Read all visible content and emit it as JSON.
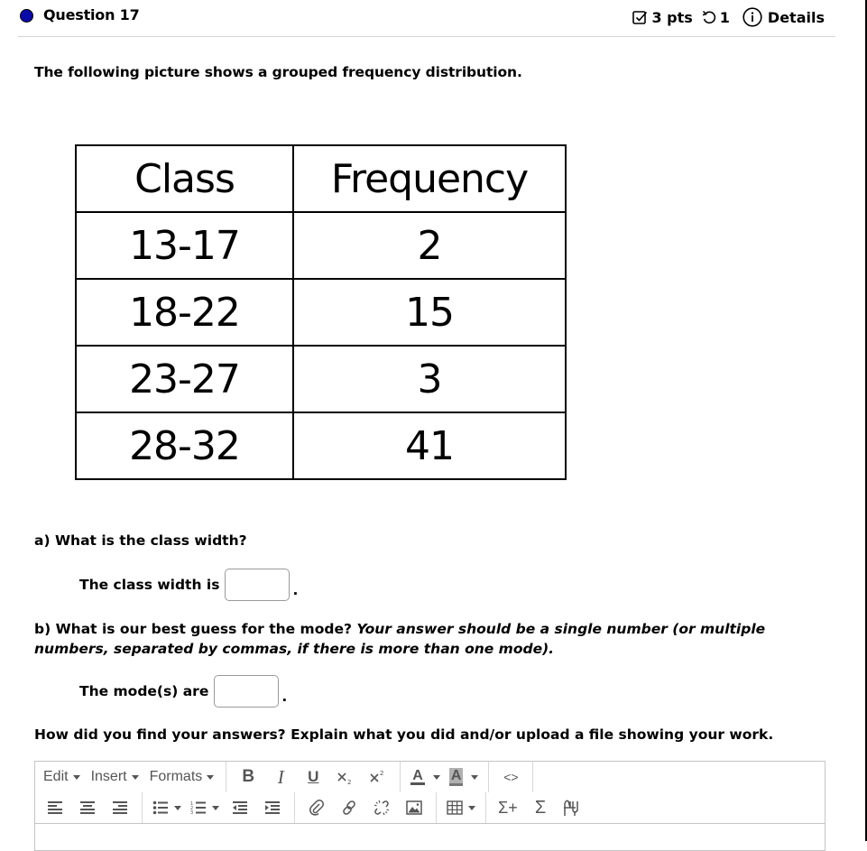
{
  "question": {
    "title": "Question 17",
    "points": "3 pts",
    "attempts": "1",
    "details_label": "Details",
    "status_color": "#0a0aa8"
  },
  "intro_text": "The following picture shows a grouped frequency distribution.",
  "table": {
    "headers": [
      "Class",
      "Frequency"
    ],
    "rows": [
      {
        "class": "13-17",
        "frequency": "2"
      },
      {
        "class": "18-22",
        "frequency": "15"
      },
      {
        "class": "23-27",
        "frequency": "3"
      },
      {
        "class": "28-32",
        "frequency": "41"
      }
    ]
  },
  "part_a": {
    "question": "a) What is the class width?",
    "prompt": "The class width is",
    "value": "",
    "suffix": "."
  },
  "part_b": {
    "question": "b) What is our best guess for the mode?",
    "instruction": "Your answer should be a single number (or multiple numbers, separated by commas, if there is more than one mode).",
    "prompt": "The mode(s) are",
    "value": "",
    "suffix": "."
  },
  "explain_prompt": "How did you find your answers? Explain what you did and/or upload a file showing your work.",
  "editor": {
    "menus": [
      "Edit",
      "Insert",
      "Formats"
    ],
    "row1_buttons": [
      {
        "icon": "bold-icon",
        "label": "B"
      },
      {
        "icon": "italic-icon",
        "label": "I"
      },
      {
        "icon": "underline-icon",
        "label": "U"
      },
      {
        "icon": "subscript-icon"
      },
      {
        "icon": "superscript-icon"
      },
      {
        "icon": "text-color-icon",
        "label": "A"
      },
      {
        "icon": "background-color-icon",
        "label": "A"
      },
      {
        "icon": "code-icon",
        "label": "<>"
      }
    ],
    "row2_buttons": [
      {
        "icon": "align-left-icon"
      },
      {
        "icon": "align-center-icon"
      },
      {
        "icon": "align-right-icon"
      },
      {
        "icon": "bullet-list-icon"
      },
      {
        "icon": "numbered-list-icon"
      },
      {
        "icon": "outdent-icon"
      },
      {
        "icon": "indent-icon"
      },
      {
        "icon": "attachment-icon"
      },
      {
        "icon": "link-icon"
      },
      {
        "icon": "unlink-icon"
      },
      {
        "icon": "image-icon"
      },
      {
        "icon": "table-icon"
      },
      {
        "icon": "insert-formula-icon",
        "label": "Σ+"
      },
      {
        "icon": "sigma-icon",
        "label": "Σ"
      },
      {
        "icon": "graph-icon"
      }
    ],
    "content": ""
  }
}
